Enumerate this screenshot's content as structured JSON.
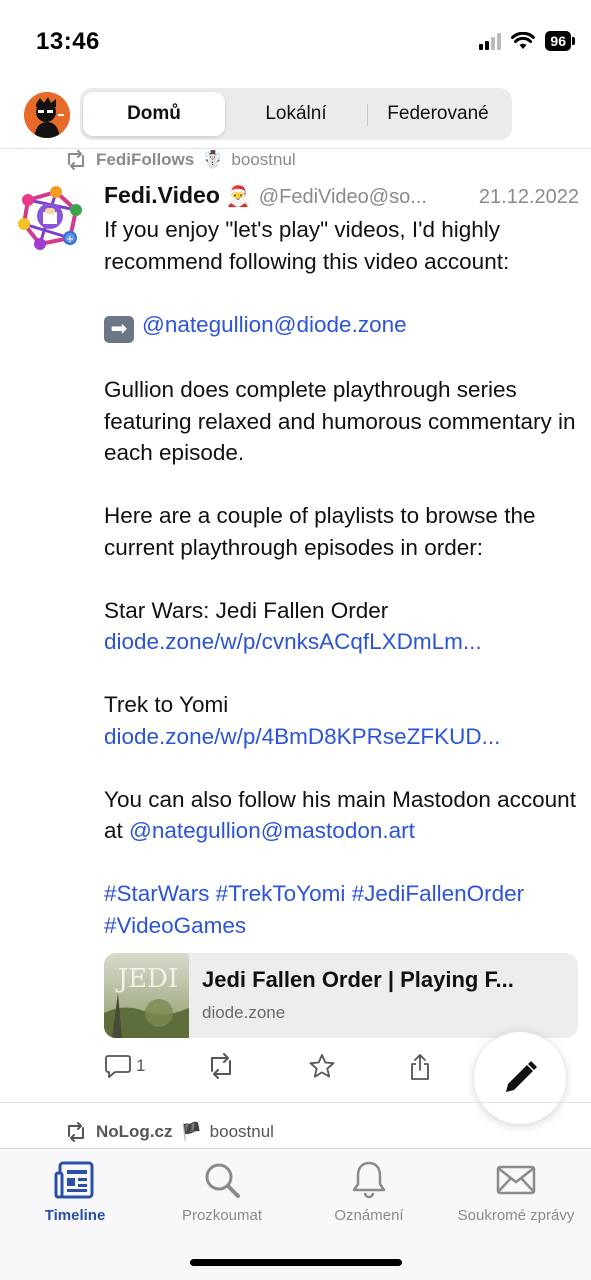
{
  "status_bar": {
    "time": "13:46",
    "battery": "96"
  },
  "timeline_tabs": [
    {
      "label": "Domů",
      "active": true
    },
    {
      "label": "Lokální",
      "active": false
    },
    {
      "label": "Federované",
      "active": false
    }
  ],
  "post": {
    "boost_user": "FediFollows",
    "boost_emoji": "☃️",
    "boost_text": "boostnul",
    "display_name": "Fedi.Video",
    "name_emoji": "🎅",
    "handle": "@FediVideo@so...",
    "date": "21.12.2022",
    "body": {
      "p1": "If you enjoy \"let's play\" videos, I'd highly recommend following this video account:",
      "arrow": "➡",
      "mention1": "@nategullion@diode.zone",
      "p3": "Gullion does complete playthrough series featuring relaxed and humorous commentary in each episode.",
      "p4": "Here are a couple of playlists to browse the current playthrough episodes in order:",
      "playlist1_title": "Star Wars: Jedi Fallen Order",
      "playlist1_link": "diode.zone/w/p/cvnksACqfLXDmLm...",
      "playlist2_title": "Trek to Yomi",
      "playlist2_link": "diode.zone/w/p/4BmD8KPRseZFKUD...",
      "p7_text": "You can also follow his main Mastodon account at",
      "mention2": "@nategullion@mastodon.art",
      "hashtags_line1": "#StarWars #TrekToYomi #JediFallenOrder",
      "hashtags_line2": "#VideoGames"
    },
    "card": {
      "title": "Jedi Fallen Order | Playing F...",
      "domain": "diode.zone",
      "thumb_text": "JEDI"
    },
    "actions": {
      "reply_count": "1"
    }
  },
  "next_post": {
    "boost_user": "NoLog.cz",
    "boost_emoji": "🏴",
    "boost_text": "boostnul"
  },
  "tabbar": [
    {
      "label": "Timeline",
      "icon": "timeline-icon",
      "active": true
    },
    {
      "label": "Prozkoumat",
      "icon": "search-icon",
      "active": false
    },
    {
      "label": "Oznámení",
      "icon": "bell-icon",
      "active": false
    },
    {
      "label": "Soukromé zprávy",
      "icon": "envelope-icon",
      "active": false
    }
  ],
  "colors": {
    "link": "#2b54d9",
    "tab_active": "#2a4fa8",
    "muted": "#8a8a8e"
  }
}
